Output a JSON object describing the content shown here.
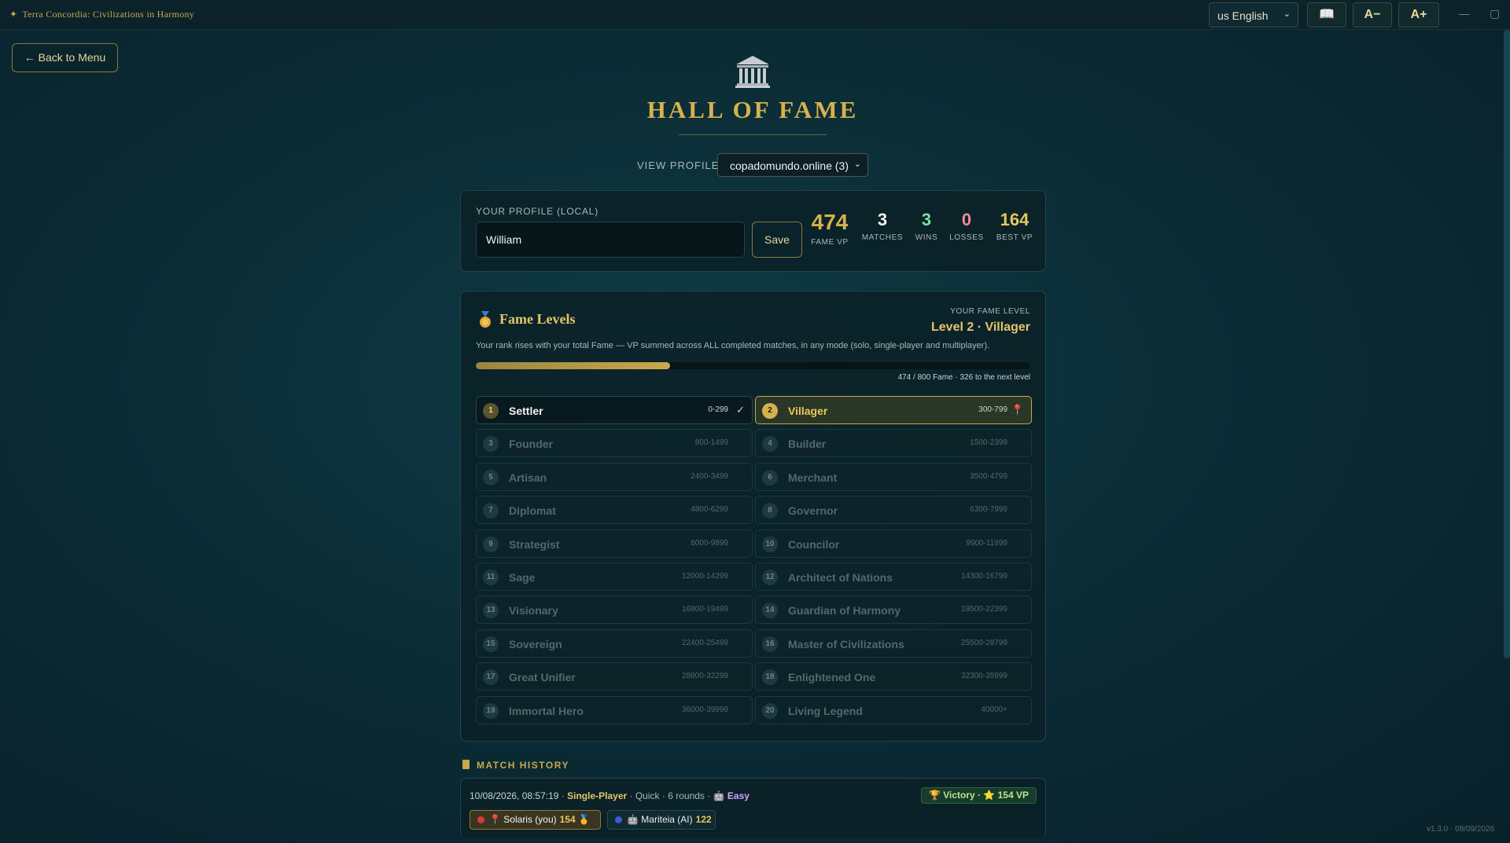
{
  "app": {
    "title": "Terra Concordia: Civilizations in Harmony",
    "language": "us English",
    "rules_icon": "📖",
    "font_decrease": "A−",
    "font_increase": "A+",
    "minimize": "—",
    "maximize": "▢",
    "version": "v1.3.0 · 08/09/2026"
  },
  "nav": {
    "back_label": "← Back to Menu"
  },
  "header": {
    "icon": "classical-building-icon",
    "title": "HALL OF FAME",
    "view_profile_label": "VIEW PROFILE:",
    "view_profile_value": "copadomundo.online (3)"
  },
  "profile": {
    "label": "YOUR PROFILE (LOCAL)",
    "name_value": "William",
    "save_label": "Save",
    "stats": [
      {
        "value": "474",
        "label": "FAME VP",
        "color": "#d6b24e"
      },
      {
        "value": "3",
        "label": "MATCHES",
        "color": "#f2f2f2"
      },
      {
        "value": "3",
        "label": "WINS",
        "color": "#7be0a0"
      },
      {
        "value": "0",
        "label": "LOSSES",
        "color": "#f08a9a"
      },
      {
        "value": "164",
        "label": "BEST VP",
        "color": "#e8c85a"
      }
    ]
  },
  "fame_levels": {
    "title": "Fame Levels",
    "your_level_label": "YOUR FAME LEVEL",
    "your_level_value": "Level 2 · Villager",
    "description": "Your rank rises with your total Fame — VP summed across ALL completed matches, in any mode (solo, single-player and multiplayer).",
    "progress_fraction": 0.35,
    "progress_text": "474 / 800 Fame · 326 to the next level",
    "levels": [
      {
        "num": "1",
        "name": "Settler",
        "range": "0-299",
        "state": "done",
        "mark": "✓"
      },
      {
        "num": "2",
        "name": "Villager",
        "range": "300-799",
        "state": "current",
        "mark": "📍"
      },
      {
        "num": "3",
        "name": "Founder",
        "range": "800-1499",
        "state": "locked",
        "mark": ""
      },
      {
        "num": "4",
        "name": "Builder",
        "range": "1500-2399",
        "state": "locked",
        "mark": ""
      },
      {
        "num": "5",
        "name": "Artisan",
        "range": "2400-3499",
        "state": "locked",
        "mark": ""
      },
      {
        "num": "6",
        "name": "Merchant",
        "range": "3500-4799",
        "state": "locked",
        "mark": ""
      },
      {
        "num": "7",
        "name": "Diplomat",
        "range": "4800-6299",
        "state": "locked",
        "mark": ""
      },
      {
        "num": "8",
        "name": "Governor",
        "range": "6300-7999",
        "state": "locked",
        "mark": ""
      },
      {
        "num": "9",
        "name": "Strategist",
        "range": "8000-9899",
        "state": "locked",
        "mark": ""
      },
      {
        "num": "10",
        "name": "Councilor",
        "range": "9900-11999",
        "state": "locked",
        "mark": ""
      },
      {
        "num": "11",
        "name": "Sage",
        "range": "12000-14299",
        "state": "locked",
        "mark": ""
      },
      {
        "num": "12",
        "name": "Architect of Nations",
        "range": "14300-16799",
        "state": "locked",
        "mark": ""
      },
      {
        "num": "13",
        "name": "Visionary",
        "range": "16800-19499",
        "state": "locked",
        "mark": ""
      },
      {
        "num": "14",
        "name": "Guardian of Harmony",
        "range": "19500-22399",
        "state": "locked",
        "mark": ""
      },
      {
        "num": "15",
        "name": "Sovereign",
        "range": "22400-25499",
        "state": "locked",
        "mark": ""
      },
      {
        "num": "16",
        "name": "Master of Civilizations",
        "range": "25500-28799",
        "state": "locked",
        "mark": ""
      },
      {
        "num": "17",
        "name": "Great Unifier",
        "range": "28800-32299",
        "state": "locked",
        "mark": ""
      },
      {
        "num": "18",
        "name": "Enlightened One",
        "range": "32300-35999",
        "state": "locked",
        "mark": ""
      },
      {
        "num": "19",
        "name": "Immortal Hero",
        "range": "36000-39999",
        "state": "locked",
        "mark": ""
      },
      {
        "num": "20",
        "name": "Living Legend",
        "range": "40000+",
        "state": "locked",
        "mark": ""
      }
    ]
  },
  "match_history": {
    "title": "MATCH HISTORY",
    "matches": [
      {
        "datetime": "10/08/2026, 08:57:19",
        "mode": "Single-Player",
        "speed": "Quick",
        "rounds": "6 rounds",
        "difficulty": "Easy",
        "result": "🏆 Victory · ⭐ 154 VP",
        "players": [
          {
            "name": "Solaris (you)",
            "score": "154",
            "color": "#d63a3a",
            "icon": "📍",
            "medal": "🥇"
          },
          {
            "name": "Mariteia (AI)",
            "score": "122",
            "color": "#3a5ad6",
            "icon": "🤖",
            "medal": ""
          }
        ]
      }
    ]
  }
}
